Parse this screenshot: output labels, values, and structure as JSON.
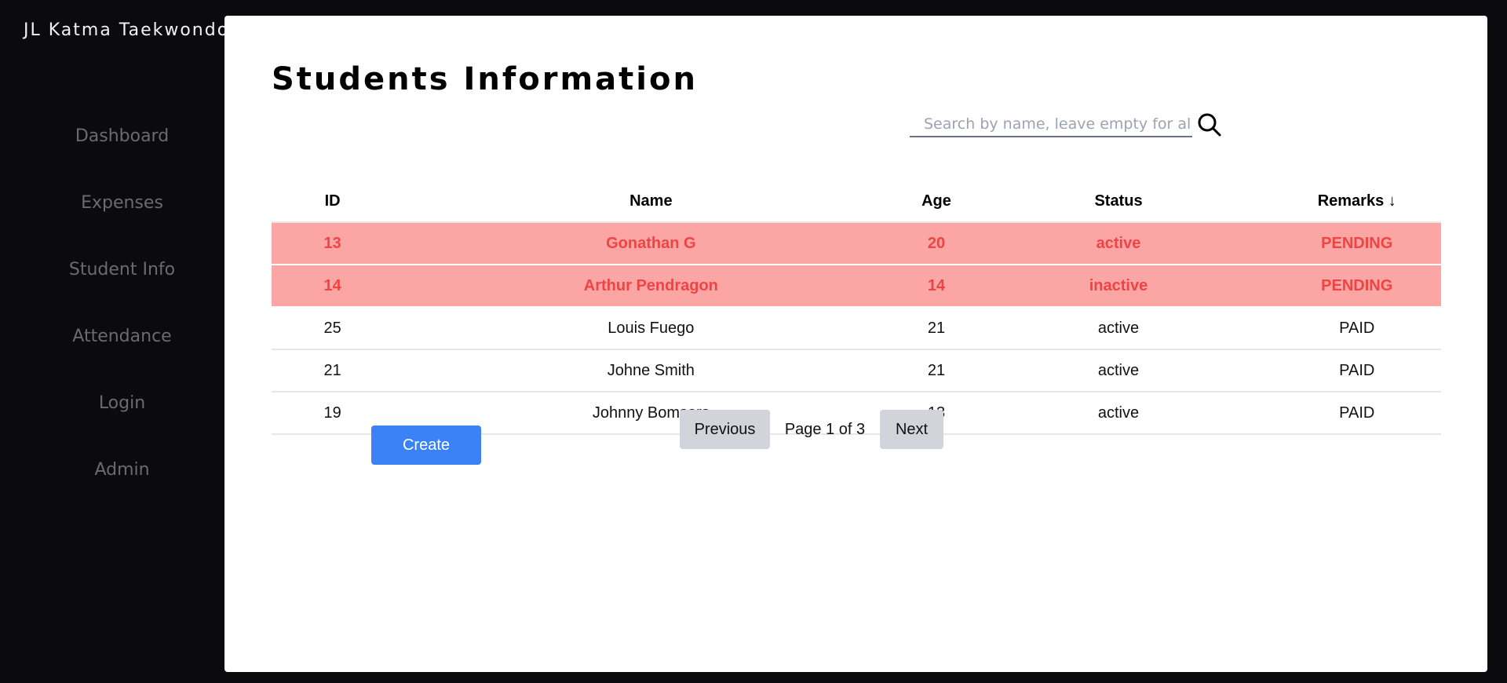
{
  "app": {
    "brand": "JL Katma Taekwondo"
  },
  "sidebar": {
    "items": [
      {
        "label": "Dashboard"
      },
      {
        "label": "Expenses"
      },
      {
        "label": "Student Info"
      },
      {
        "label": "Attendance"
      },
      {
        "label": "Login"
      },
      {
        "label": "Admin"
      }
    ]
  },
  "main": {
    "title": "Students Information",
    "search": {
      "placeholder": "Search by name, leave empty for all",
      "value": "",
      "icon": "search-icon"
    },
    "table": {
      "headers": [
        "ID",
        "Name",
        "Age",
        "Status",
        "Remarks ↓"
      ],
      "rows": [
        {
          "id": "13",
          "name": "Gonathan G",
          "age": "20",
          "status": "active",
          "remarks": "PENDING"
        },
        {
          "id": "14",
          "name": "Arthur Pendragon",
          "age": "14",
          "status": "inactive",
          "remarks": "PENDING"
        },
        {
          "id": "25",
          "name": "Louis Fuego",
          "age": "21",
          "status": "active",
          "remarks": "PAID"
        },
        {
          "id": "21",
          "name": "Johne Smith",
          "age": "21",
          "status": "active",
          "remarks": "PAID"
        },
        {
          "id": "19",
          "name": "Johnny Bomsers",
          "age": "13",
          "status": "active",
          "remarks": "PAID"
        }
      ]
    },
    "create_label": "Create",
    "pagination": {
      "previous_label": "Previous",
      "page_text": "Page 1 of 3",
      "next_label": "Next"
    }
  },
  "colors": {
    "sidebar_bg": "#0b0b0d",
    "pending_row_bg": "#fca5a5",
    "pending_text": "#ef4444",
    "create_button": "#3b82f6",
    "pager_button": "#d1d5db"
  }
}
